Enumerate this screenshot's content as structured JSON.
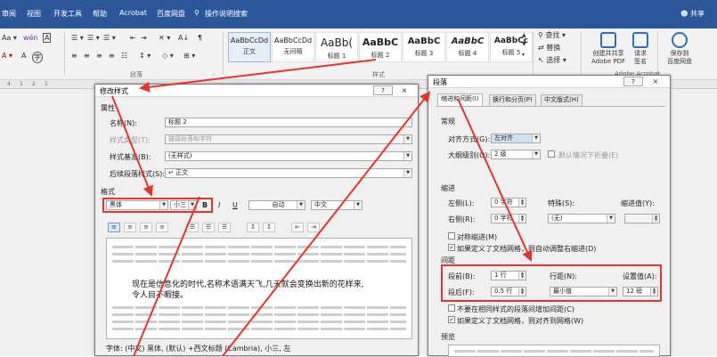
{
  "menubar": {
    "tabs": [
      "审阅",
      "视图",
      "开发工具",
      "帮助",
      "Acrobat",
      "百度网盘"
    ],
    "search": "操作说明搜索",
    "share": "共享"
  },
  "ribbon": {
    "font_box": "Aa",
    "paragraph_group": "段落",
    "styles_group": "样式",
    "styles": [
      {
        "sample": "AaBbCcDd",
        "name": "正文"
      },
      {
        "sample": "AaBbCcDd",
        "name": "无间隔"
      },
      {
        "sample": "AaBb(",
        "name": "标题 1"
      },
      {
        "sample": "AaBbC",
        "name": "标题 2"
      },
      {
        "sample": "AaBbC",
        "name": "标题 3"
      },
      {
        "sample": "AaBbC",
        "name": "标题 4"
      },
      {
        "sample": "AaBbCc",
        "name": "标题 5"
      }
    ],
    "editing": {
      "find": "查找",
      "replace": "替换",
      "select": "选择"
    },
    "adobe": {
      "label1": "创建并共享",
      "label2": "Adobe PDF",
      "label3": "请求",
      "label4": "签名",
      "group": "Adobe Acrobat"
    },
    "baidu": {
      "label1": "保存到",
      "label2": "百度网盘"
    }
  },
  "ruler": {
    "ticks": [
      "4",
      "1",
      "2",
      "1"
    ]
  },
  "modify_dialog": {
    "title": "修改样式",
    "help": "?",
    "close": "×",
    "section_props": "属性",
    "name_label": "名称(N):",
    "name_value": "标题 2",
    "type_label": "样式类型(T):",
    "type_value": "链接段落和字符",
    "based_label": "样式基准(B):",
    "based_value": "(无样式)",
    "next_label": "后续段落样式(S):",
    "next_value": "↵ 正文",
    "section_format": "格式",
    "font": "黑体",
    "size": "小三",
    "bold": "B",
    "italic": "I",
    "underline": "U",
    "color": "自动",
    "lang": "中文",
    "sample_text_1": "现在是信息化的时代,名称术语满天飞,几天就会变换出新的花样来,",
    "sample_text_2": "令人目不暇接。",
    "footer": "字体: (中文) 黑体, (默认) +西文标题 (Cambria), 小三, 左"
  },
  "para_dialog": {
    "title": "段落",
    "help": "?",
    "close": "×",
    "tabs": [
      "缩进和间距(I)",
      "换行和分页(P)",
      "中文版式(H)"
    ],
    "general": "常规",
    "align_label": "对齐方式(G):",
    "align_value": "左对齐",
    "outline_label": "大纲级别(O):",
    "outline_value": "2 级",
    "collapse": "默认情况下折叠(E)",
    "indent": "缩进",
    "left_label": "左侧(L):",
    "left_value": "0 字符",
    "right_label": "右侧(R):",
    "right_value": "0 字符",
    "special_label": "特殊(S):",
    "special_value": "(无)",
    "indent_val_label": "缩进值(Y):",
    "mirror": "对称缩进(M)",
    "auto_adjust": "如果定义了文档网格，则自动调整右缩进(D)",
    "spacing": "间距",
    "before_label": "段前(B):",
    "before_value": "1 行",
    "after_label": "段后(F):",
    "after_value": "0.5 行",
    "line_label": "行距(N):",
    "line_value": "最小值",
    "setval_label": "设置值(A):",
    "setval_value": "12 磅",
    "no_space": "不要在相同样式的段落间增加间距(C)",
    "snap_grid": "如果定义了文档网格，则对齐到网格(W)",
    "preview": "预览"
  }
}
